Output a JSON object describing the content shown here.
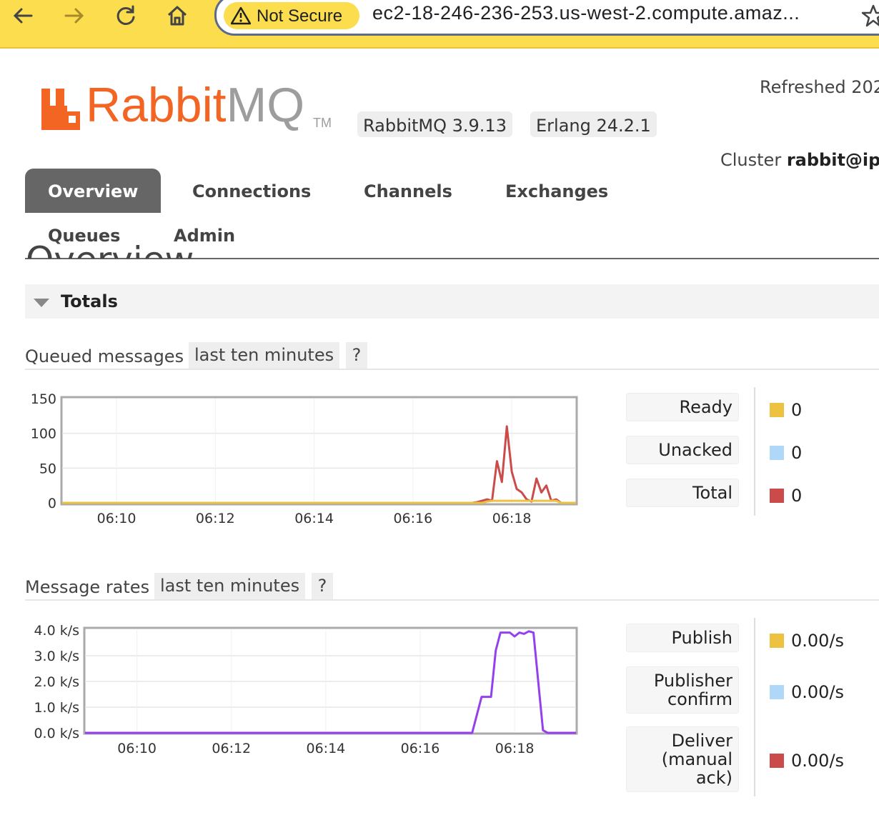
{
  "browser": {
    "security_label": "Not Secure",
    "url": "ec2-18-246-236-253.us-west-2.compute.amaz..."
  },
  "header": {
    "logo_text_orange": "Rabbit",
    "logo_text_grey": "MQ",
    "logo_tm": "TM",
    "version_badge": "RabbitMQ 3.9.13",
    "erlang_badge": "Erlang 24.2.1",
    "refreshed_text": "Refreshed 202",
    "cluster_label": "Cluster",
    "cluster_name": "rabbit@ip"
  },
  "tabs": [
    {
      "label": "Overview",
      "active": true
    },
    {
      "label": "Connections",
      "active": false
    },
    {
      "label": "Channels",
      "active": false
    },
    {
      "label": "Exchanges",
      "active": false
    },
    {
      "label": "Queues",
      "active": false
    },
    {
      "label": "Admin",
      "active": false
    }
  ],
  "page_title": "Overview",
  "totals": {
    "label": "Totals"
  },
  "queued": {
    "title": "Queued messages",
    "range": "last ten minutes",
    "help": "?",
    "legend": [
      {
        "label": "Ready",
        "value": "0",
        "color": "#edc240"
      },
      {
        "label": "Unacked",
        "value": "0",
        "color": "#afd8f8"
      },
      {
        "label": "Total",
        "value": "0",
        "color": "#cb4b4b"
      }
    ]
  },
  "rates": {
    "title": "Message rates",
    "range": "last ten minutes",
    "help": "?",
    "legend": [
      {
        "label": "Publish",
        "value": "0.00/s",
        "color": "#edc240"
      },
      {
        "label": "Publisher confirm",
        "value": "0.00/s",
        "color": "#afd8f8"
      },
      {
        "label": "Deliver (manual ack)",
        "value": "0.00/s",
        "color": "#cb4b4b"
      }
    ]
  },
  "chart_data": [
    {
      "type": "line",
      "x_ticks": [
        "06:10",
        "06:12",
        "06:14",
        "06:16",
        "06:18"
      ],
      "y_ticks": [
        "0",
        "50",
        "100",
        "150"
      ],
      "ylim": [
        0,
        150
      ],
      "x": [
        "06:08.9",
        "06:17.2",
        "06:17.3",
        "06:17.4",
        "06:17.5",
        "06:17.6",
        "06:17.7",
        "06:17.8",
        "06:17.9",
        "06:18.0",
        "06:18.1",
        "06:18.2",
        "06:18.3",
        "06:18.4",
        "06:18.5",
        "06:18.6",
        "06:18.7",
        "06:18.8",
        "06:18.9",
        "06:19.0",
        "06:19.1",
        "06:19.3"
      ],
      "series": [
        {
          "name": "Total",
          "color": "#cb4b4b",
          "values": [
            0,
            0,
            1,
            3,
            5,
            3,
            60,
            30,
            110,
            45,
            20,
            15,
            5,
            2,
            35,
            15,
            25,
            3,
            5,
            0,
            0,
            0
          ]
        },
        {
          "name": "Ready",
          "color": "#edc240",
          "values": [
            0,
            0,
            0,
            0,
            2,
            3,
            3,
            3,
            3,
            3,
            3,
            3,
            3,
            3,
            3,
            3,
            3,
            3,
            3,
            0,
            0,
            0
          ]
        }
      ]
    },
    {
      "type": "line",
      "x_ticks": [
        "06:10",
        "06:12",
        "06:14",
        "06:16",
        "06:18"
      ],
      "y_ticks": [
        "0.0 k/s",
        "1.0 k/s",
        "2.0 k/s",
        "3.0 k/s",
        "4.0 k/s"
      ],
      "ylim": [
        0,
        4
      ],
      "x": [
        "06:08.9",
        "06:17.1",
        "06:17.3",
        "06:17.5",
        "06:17.6",
        "06:17.7",
        "06:17.8",
        "06:17.9",
        "06:18.0",
        "06:18.1",
        "06:18.2",
        "06:18.3",
        "06:18.4",
        "06:18.6",
        "06:18.7",
        "06:19.3"
      ],
      "series": [
        {
          "name": "",
          "color": "#9440ed",
          "values": [
            0,
            0,
            1.4,
            1.4,
            3.2,
            3.9,
            3.9,
            3.9,
            3.75,
            3.9,
            3.85,
            3.95,
            3.9,
            0.1,
            0,
            0
          ]
        }
      ]
    }
  ]
}
